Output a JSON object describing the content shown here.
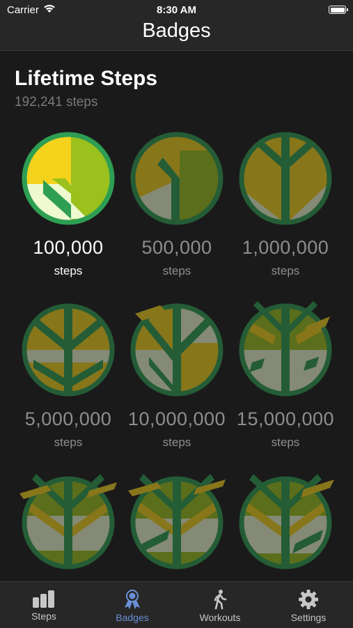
{
  "status_bar": {
    "carrier": "Carrier",
    "time": "8:30 AM"
  },
  "nav": {
    "title": "Badges"
  },
  "section": {
    "title": "Lifetime Steps",
    "subtitle": "192,241 steps"
  },
  "badges": [
    {
      "value": "100,000",
      "unit": "steps",
      "earned": true
    },
    {
      "value": "500,000",
      "unit": "steps",
      "earned": false
    },
    {
      "value": "1,000,000",
      "unit": "steps",
      "earned": false
    },
    {
      "value": "5,000,000",
      "unit": "steps",
      "earned": false
    },
    {
      "value": "10,000,000",
      "unit": "steps",
      "earned": false
    },
    {
      "value": "15,000,000",
      "unit": "steps",
      "earned": false
    },
    {
      "value": "",
      "unit": "",
      "earned": false
    },
    {
      "value": "",
      "unit": "",
      "earned": false
    },
    {
      "value": "",
      "unit": "",
      "earned": false
    }
  ],
  "tabs": [
    {
      "label": "Steps",
      "icon": "bar-chart-icon",
      "active": false
    },
    {
      "label": "Badges",
      "icon": "ribbon-badge-icon",
      "active": true
    },
    {
      "label": "Workouts",
      "icon": "walking-person-icon",
      "active": false
    },
    {
      "label": "Settings",
      "icon": "gear-icon",
      "active": false
    }
  ],
  "colors": {
    "background": "#1a1a1a",
    "bar": "#272727",
    "active_tab": "#6a8fd6",
    "inactive_tab": "#c7c7c7",
    "badge_ring": "#2e9e53",
    "badge_yellow": "#f5d21c",
    "badge_lime": "#9bc11c",
    "badge_light": "#eef9cf"
  }
}
